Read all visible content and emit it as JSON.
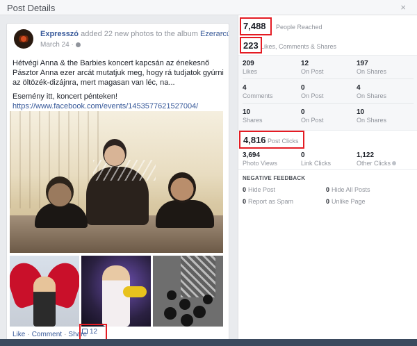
{
  "dialog": {
    "title": "Post Details",
    "close": "×"
  },
  "post": {
    "page_name": "Expresszó",
    "action_text": "added 22 new photos to the album",
    "album_name": "Ezerarcú Anna",
    "date": "March 24 ·",
    "paragraph1": "Hétvégi Anna & the Barbies koncert kapcsán az énekesnő Pásztor Anna ezer arcát mutatjuk meg, hogy rá tudjatok gyúrni az öltözék-dizájnra, mert magasan van léc, na...",
    "paragraph2": "Esemény itt, koncert pénteken!",
    "link": "https://www.facebook.com/events/1453577621527004/",
    "actions": {
      "like": "Like",
      "comment": "Comment",
      "share": "Share",
      "like_count": "12"
    }
  },
  "insights": {
    "people_reached": {
      "value": "7,488",
      "label": "People Reached"
    },
    "engagement": {
      "value": "223",
      "label": "Likes, Comments & Shares"
    },
    "rows": [
      [
        {
          "value": "209",
          "label": "Likes"
        },
        {
          "value": "12",
          "label": "On Post"
        },
        {
          "value": "197",
          "label": "On Shares"
        }
      ],
      [
        {
          "value": "4",
          "label": "Comments"
        },
        {
          "value": "0",
          "label": "On Post"
        },
        {
          "value": "4",
          "label": "On Shares"
        }
      ],
      [
        {
          "value": "10",
          "label": "Shares"
        },
        {
          "value": "0",
          "label": "On Post"
        },
        {
          "value": "10",
          "label": "On Shares"
        }
      ]
    ],
    "post_clicks": {
      "value": "4,816",
      "label": "Post Clicks"
    },
    "click_breakdown": [
      {
        "value": "3,694",
        "label": "Photo Views"
      },
      {
        "value": "0",
        "label": "Link Clicks"
      },
      {
        "value": "1,122",
        "label": "Other Clicks"
      }
    ],
    "negative_feedback": {
      "title": "NEGATIVE FEEDBACK",
      "items": [
        {
          "value": "0",
          "label": "Hide Post"
        },
        {
          "value": "0",
          "label": "Hide All Posts"
        },
        {
          "value": "0",
          "label": "Report as Spam"
        },
        {
          "value": "0",
          "label": "Unlike Page"
        }
      ]
    }
  },
  "colors": {
    "highlight_box": "#e41b23",
    "link": "#365899"
  }
}
